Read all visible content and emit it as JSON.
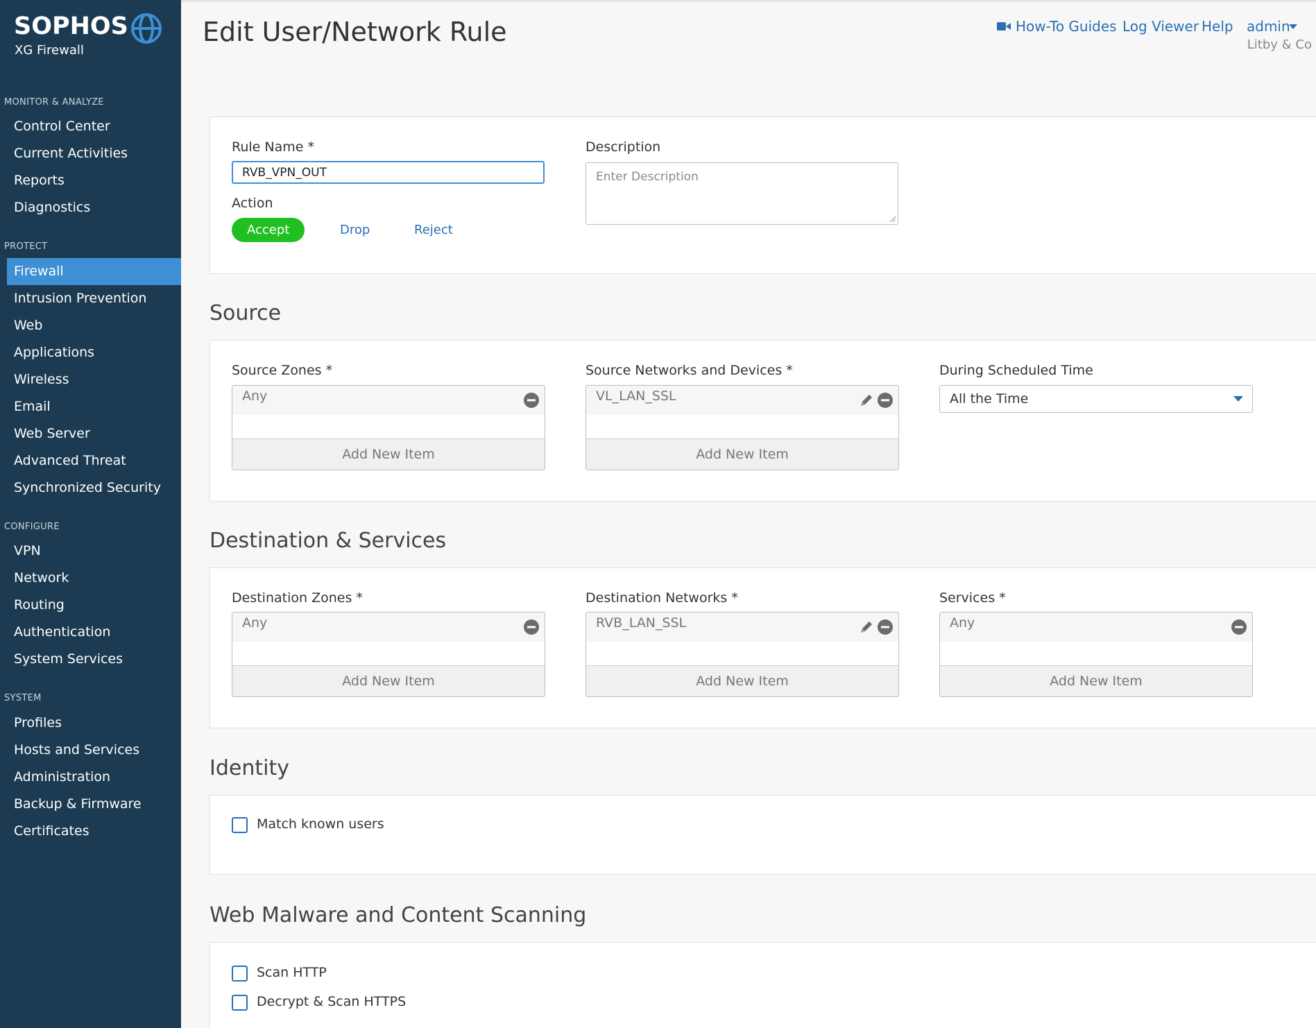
{
  "brand": {
    "name": "SOPHOS",
    "product": "XG Firewall"
  },
  "sidebar": {
    "sections": [
      {
        "label": "MONITOR & ANALYZE",
        "items": [
          "Control Center",
          "Current Activities",
          "Reports",
          "Diagnostics"
        ]
      },
      {
        "label": "PROTECT",
        "items": [
          "Firewall",
          "Intrusion Prevention",
          "Web",
          "Applications",
          "Wireless",
          "Email",
          "Web Server",
          "Advanced Threat",
          "Synchronized Security"
        ]
      },
      {
        "label": "CONFIGURE",
        "items": [
          "VPN",
          "Network",
          "Routing",
          "Authentication",
          "System Services"
        ]
      },
      {
        "label": "SYSTEM",
        "items": [
          "Profiles",
          "Hosts and Services",
          "Administration",
          "Backup & Firmware",
          "Certificates"
        ]
      }
    ],
    "active_item": "Firewall"
  },
  "header": {
    "title": "Edit User/Network Rule",
    "links": {
      "guides": "How-To Guides",
      "log_viewer": "Log Viewer",
      "help": "Help",
      "user": "admin"
    },
    "org": "Litby & Co"
  },
  "rule": {
    "name_label": "Rule Name *",
    "name_value": "RVB_VPN_OUT",
    "description_label": "Description",
    "description_placeholder": "Enter Description",
    "action_label": "Action",
    "actions": {
      "accept": "Accept",
      "drop": "Drop",
      "reject": "Reject"
    },
    "selected_action": "Accept"
  },
  "source": {
    "title": "Source",
    "zones_label": "Source Zones *",
    "zones_value": "Any",
    "networks_label": "Source Networks and Devices *",
    "networks_value": "VL_LAN_SSL",
    "schedule_label": "During Scheduled Time",
    "schedule_value": "All the Time",
    "add_label": "Add New Item"
  },
  "destination": {
    "title": "Destination & Services",
    "zones_label": "Destination Zones *",
    "zones_value": "Any",
    "networks_label": "Destination Networks *",
    "networks_value": "RVB_LAN_SSL",
    "services_label": "Services *",
    "services_value": "Any",
    "add_label": "Add New Item"
  },
  "identity": {
    "title": "Identity",
    "match_users_label": "Match known users",
    "match_users_checked": false
  },
  "scanning": {
    "title": "Web Malware and Content Scanning",
    "scan_http_label": "Scan HTTP",
    "scan_http_checked": false,
    "scan_https_label": "Decrypt & Scan HTTPS",
    "scan_https_checked": false
  },
  "colors": {
    "sidebar_bg": "#1c3b52",
    "active_nav": "#3e8fd4",
    "link": "#2a6fb5",
    "accept": "#20c020"
  }
}
